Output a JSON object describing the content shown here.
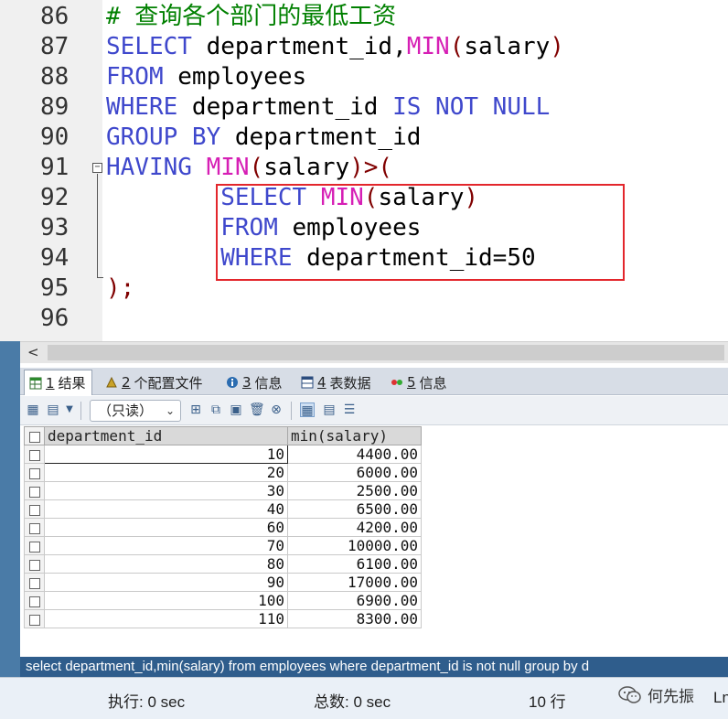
{
  "editor": {
    "lines": [
      {
        "num": "86",
        "tokens": [
          {
            "t": "# 查询各个部门的最低工资",
            "c": "cm"
          }
        ]
      },
      {
        "num": "87",
        "tokens": [
          {
            "t": "SELECT",
            "c": "kw"
          },
          {
            "t": " department_id,",
            "c": ""
          },
          {
            "t": "MIN",
            "c": "fn"
          },
          {
            "t": "(",
            "c": "pn"
          },
          {
            "t": "salary",
            "c": ""
          },
          {
            "t": ")",
            "c": "pn"
          }
        ]
      },
      {
        "num": "88",
        "tokens": [
          {
            "t": "FROM",
            "c": "kw"
          },
          {
            "t": " employees",
            "c": ""
          }
        ]
      },
      {
        "num": "89",
        "tokens": [
          {
            "t": "WHERE",
            "c": "kw"
          },
          {
            "t": " department_id ",
            "c": ""
          },
          {
            "t": "IS NOT NULL",
            "c": "kw"
          }
        ]
      },
      {
        "num": "90",
        "tokens": [
          {
            "t": "GROUP BY",
            "c": "kw"
          },
          {
            "t": " department_id",
            "c": ""
          }
        ]
      },
      {
        "num": "91",
        "tokens": [
          {
            "t": "HAVING",
            "c": "kw"
          },
          {
            "t": " ",
            "c": ""
          },
          {
            "t": "MIN",
            "c": "fn"
          },
          {
            "t": "(",
            "c": "pn"
          },
          {
            "t": "salary",
            "c": ""
          },
          {
            "t": ")>(",
            "c": "pn"
          }
        ]
      },
      {
        "num": "92",
        "tokens": [
          {
            "t": "        ",
            "c": ""
          },
          {
            "t": "SELECT",
            "c": "kw"
          },
          {
            "t": " ",
            "c": ""
          },
          {
            "t": "MIN",
            "c": "fn"
          },
          {
            "t": "(",
            "c": "pn"
          },
          {
            "t": "salary",
            "c": ""
          },
          {
            "t": ")",
            "c": "pn"
          }
        ]
      },
      {
        "num": "93",
        "tokens": [
          {
            "t": "        ",
            "c": ""
          },
          {
            "t": "FROM",
            "c": "kw"
          },
          {
            "t": " employees",
            "c": ""
          }
        ]
      },
      {
        "num": "94",
        "tokens": [
          {
            "t": "        ",
            "c": ""
          },
          {
            "t": "WHERE",
            "c": "kw"
          },
          {
            "t": " department_id=50",
            "c": ""
          }
        ]
      },
      {
        "num": "95",
        "tokens": [
          {
            "t": ");",
            "c": "pn"
          }
        ]
      },
      {
        "num": "96",
        "tokens": []
      }
    ]
  },
  "tabs": [
    {
      "num": "1",
      "label": "结果",
      "icon": "table-icon"
    },
    {
      "num": "2",
      "label": "个配置文件",
      "icon": "profile-icon"
    },
    {
      "num": "3",
      "label": "信息",
      "icon": "info-icon"
    },
    {
      "num": "4",
      "label": "表数据",
      "icon": "table-data-icon"
    },
    {
      "num": "5",
      "label": "信息",
      "icon": "info-icon"
    }
  ],
  "toolbar": {
    "readonly_label": "（只读）"
  },
  "grid": {
    "columns": [
      "department_id",
      "min(salary)"
    ],
    "rows": [
      [
        "10",
        "4400.00"
      ],
      [
        "20",
        "6000.00"
      ],
      [
        "30",
        "2500.00"
      ],
      [
        "40",
        "6500.00"
      ],
      [
        "60",
        "4200.00"
      ],
      [
        "70",
        "10000.00"
      ],
      [
        "80",
        "6100.00"
      ],
      [
        "90",
        "17000.00"
      ],
      [
        "100",
        "6900.00"
      ],
      [
        "110",
        "8300.00"
      ]
    ]
  },
  "sql_strip": "select department_id,min(salary) from employees where department_id is not null group by d",
  "status": {
    "exec": "执行: 0 sec",
    "total": "总数: 0 sec",
    "rows": "10 行",
    "watermark": "何先振",
    "ln": "Ln"
  }
}
